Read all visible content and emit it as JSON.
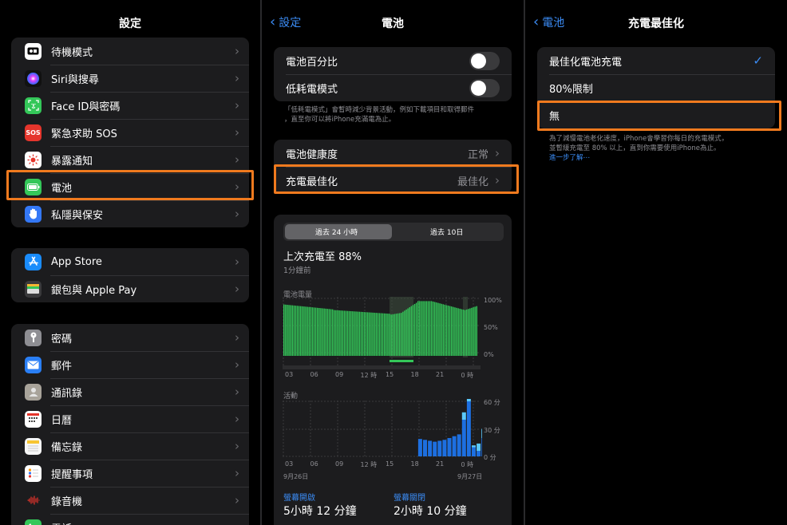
{
  "settings": {
    "title": "設定",
    "group1": [
      {
        "label": "待機模式",
        "icon": "standby-icon",
        "color": "#1c1c1e"
      },
      {
        "label": "Siri與搜尋",
        "icon": "siri-icon",
        "color": "#222"
      },
      {
        "label": "Face ID與密碼",
        "icon": "faceid-icon",
        "color": "#34c759"
      },
      {
        "label": "緊急求助 SOS",
        "icon": "sos-icon",
        "color": "#e5352c",
        "glyph": "SOS"
      },
      {
        "label": "暴露通知",
        "icon": "exposure-icon",
        "color": "#ffffff"
      },
      {
        "label": "電池",
        "icon": "battery-icon",
        "color": "#34c759"
      },
      {
        "label": "私隱與保安",
        "icon": "privacy-hand-icon",
        "color": "#3478f6"
      }
    ],
    "group2": [
      {
        "label": "App Store",
        "icon": "app-store-icon",
        "color": "#1a8cfb"
      },
      {
        "label": "銀包與 Apple Pay",
        "icon": "wallet-icon",
        "color": "#3a3a3c"
      }
    ],
    "group3": [
      {
        "label": "密碼",
        "icon": "key-icon",
        "color": "#8e8e93"
      },
      {
        "label": "郵件",
        "icon": "mail-icon",
        "color": "#2a7ff6"
      },
      {
        "label": "通訊錄",
        "icon": "contacts-icon",
        "color": "#a8a39a"
      },
      {
        "label": "日曆",
        "icon": "calendar-icon",
        "color": "#ffffff"
      },
      {
        "label": "備忘錄",
        "icon": "notes-icon",
        "color": "#f7f7f7"
      },
      {
        "label": "提醒事項",
        "icon": "reminders-icon",
        "color": "#ffffff"
      },
      {
        "label": "錄音機",
        "icon": "voice-memos-icon",
        "color": "#1c1c1e"
      },
      {
        "label": "電話",
        "icon": "phone-icon",
        "color": "#34c759"
      }
    ]
  },
  "battery": {
    "back_label": "設定",
    "title": "電池",
    "percentage_label": "電池百分比",
    "low_power_label": "低耗電模式",
    "low_power_note_1": "「低耗電模式」會暫時減少背景活動，例如下載項目和取得郵件",
    "low_power_note_2": "，直至你可以將iPhone充滿電為止。",
    "health_label": "電池健康度",
    "health_value": "正常",
    "charging_label": "充電最佳化",
    "charging_value": "最佳化",
    "tab_24h": "過去 24 小時",
    "tab_10d": "過去 10日",
    "last_charge": "上次充電至 88%",
    "last_charge_time": "1分鐘前",
    "level_label": "電池電量",
    "level_ticks": [
      "100%",
      "50%",
      "0%"
    ],
    "activity_label": "活動",
    "activity_ticks": [
      "60 分",
      "30 分",
      "0 分"
    ],
    "x_ticks": [
      "03",
      "06",
      "09",
      "12 時",
      "15",
      "18",
      "21",
      "0 時"
    ],
    "activity_x_ticks": [
      "03",
      "06",
      "09",
      "12 時",
      "15",
      "18",
      "21",
      "0 時"
    ],
    "date_left": "9月26日",
    "date_right": "9月27日",
    "screen_on_label": "螢幕開啟",
    "screen_on_value": "5小時 12 分鐘",
    "screen_off_label": "螢幕關閉",
    "screen_off_value": "2小時 10 分鐘"
  },
  "charging": {
    "back_label": "電池",
    "title": "充電最佳化",
    "options": [
      "最佳化電池充電",
      "80%限制",
      "無"
    ],
    "note_1": "為了減慢電池老化速度，iPhone會學習你每日的充電模式，",
    "note_2": "並暫緩充電至 80% 以上，直到你需要使用iPhone為止。",
    "learn_more": "進一步了解⋯"
  },
  "colors": {
    "accent": "#3b8cf5",
    "highlight": "#f07a1e",
    "battery_green": "#34c759",
    "activity_dark": "#1d6fe0",
    "activity_light": "#5ac8fa"
  }
}
